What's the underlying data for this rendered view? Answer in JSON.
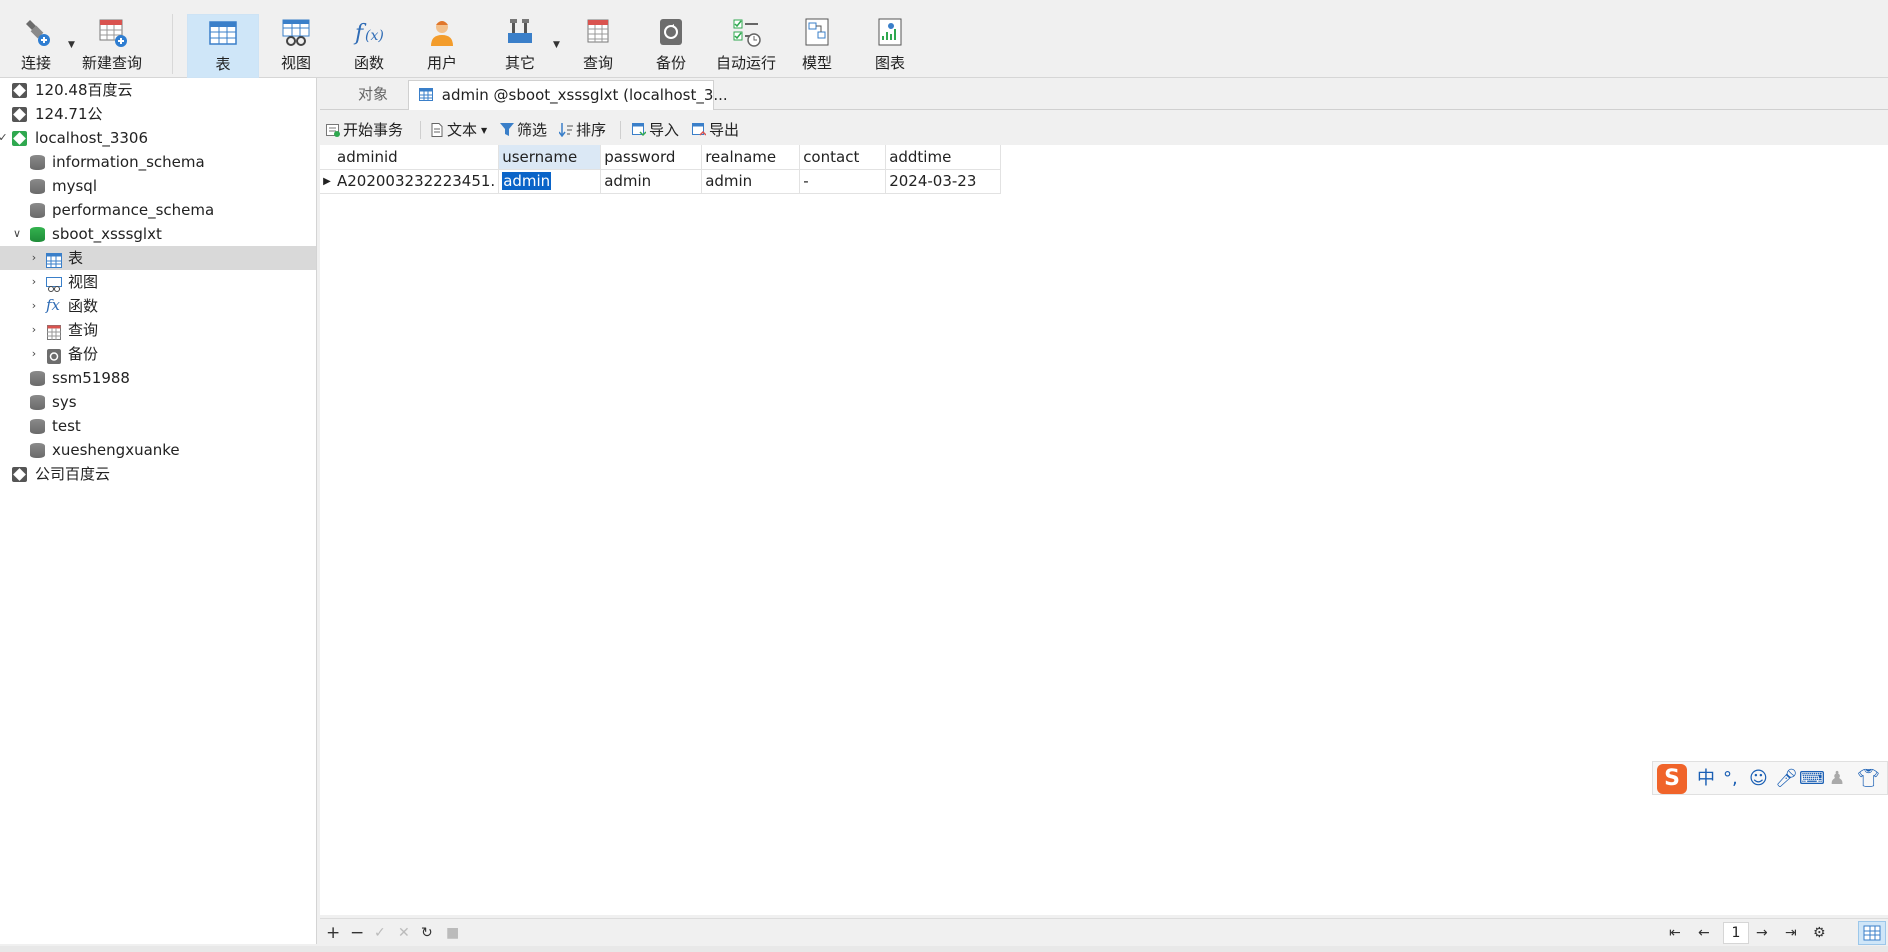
{
  "toolbar": {
    "buttons": [
      {
        "label": "连接",
        "icon": "plug-connect-icon"
      },
      {
        "label": "新建查询",
        "icon": "new-query-icon"
      },
      {
        "label": "表",
        "icon": "table-icon",
        "active": true
      },
      {
        "label": "视图",
        "icon": "view-icon"
      },
      {
        "label": "函数",
        "icon": "function-icon"
      },
      {
        "label": "用户",
        "icon": "user-icon"
      },
      {
        "label": "其它",
        "icon": "tools-icon"
      },
      {
        "label": "查询",
        "icon": "query-icon"
      },
      {
        "label": "备份",
        "icon": "backup-icon"
      },
      {
        "label": "自动运行",
        "icon": "schedule-icon"
      },
      {
        "label": "模型",
        "icon": "model-icon"
      },
      {
        "label": "图表",
        "icon": "chart-icon"
      }
    ]
  },
  "nav": {
    "items": [
      {
        "label": "120.48百度云",
        "type": "connection"
      },
      {
        "label": "124.71公",
        "type": "connection"
      },
      {
        "label": "localhost_3306",
        "type": "connection-open"
      },
      {
        "label": "information_schema",
        "type": "database"
      },
      {
        "label": "mysql",
        "type": "database"
      },
      {
        "label": "performance_schema",
        "type": "database"
      },
      {
        "label": "sboot_xsssglxt",
        "type": "database-open"
      },
      {
        "label": "表",
        "type": "tables",
        "selected": true
      },
      {
        "label": "视图",
        "type": "views"
      },
      {
        "label": "函数",
        "type": "functions"
      },
      {
        "label": "查询",
        "type": "queries"
      },
      {
        "label": "备份",
        "type": "backups"
      },
      {
        "label": "ssm51988",
        "type": "database"
      },
      {
        "label": "sys",
        "type": "database"
      },
      {
        "label": "test",
        "type": "database"
      },
      {
        "label": "xueshengxuanke",
        "type": "database"
      },
      {
        "label": "公司百度云",
        "type": "connection"
      }
    ]
  },
  "tabs": {
    "objects": "对象",
    "active": "admin @sboot_xsssglxt (localhost_3..."
  },
  "subtoolbar": {
    "begin_transaction": "开始事务",
    "text": "文本",
    "filter": "筛选",
    "sort": "排序",
    "import": "导入",
    "export": "导出"
  },
  "grid": {
    "columns": [
      "adminid",
      "username",
      "password",
      "realname",
      "contact",
      "addtime"
    ],
    "rows": [
      [
        "A202003232223451.",
        "admin",
        "admin",
        "admin",
        "-",
        "2024-03-23"
      ]
    ]
  },
  "ime": {
    "logo": "S",
    "mode": "中",
    "punct": "°,"
  },
  "bottombar": {
    "page": "1"
  },
  "colors": {
    "accent": "#0a64c8",
    "active_tab_bg": "#cfe6f8",
    "selected_header": "#dbe8f5",
    "connection_green": "#2fa84f"
  }
}
